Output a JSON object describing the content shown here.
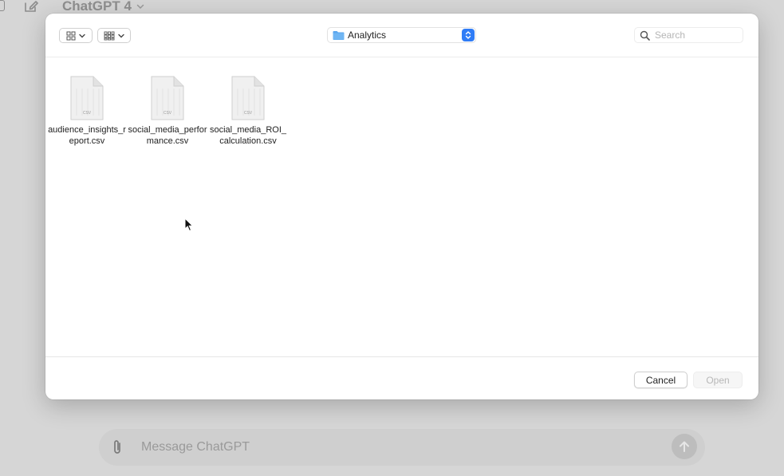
{
  "background_app": {
    "model_name": "ChatGPT 4",
    "composer_placeholder": "Message ChatGPT"
  },
  "dialog": {
    "toolbar": {
      "location": "Analytics",
      "search_placeholder": "Search"
    },
    "files": [
      {
        "name": "audience_insights_report.csv",
        "type_label": "CSV"
      },
      {
        "name": "social_media_performance.csv",
        "type_label": "CSV"
      },
      {
        "name": "social_media_ROI_calculation.csv",
        "type_label": "CSV"
      }
    ],
    "footer": {
      "cancel_label": "Cancel",
      "open_label": "Open"
    }
  },
  "colors": {
    "accent": "#2f7cf6",
    "folder": "#5aa6ef",
    "overlay": "#d6d6d6"
  },
  "icons": {
    "view": "grid-icon",
    "group": "group-grid-icon",
    "search": "search-icon",
    "folder": "folder-icon",
    "file": "csv-file-icon",
    "attach": "paperclip-icon",
    "send": "arrow-up-icon"
  }
}
